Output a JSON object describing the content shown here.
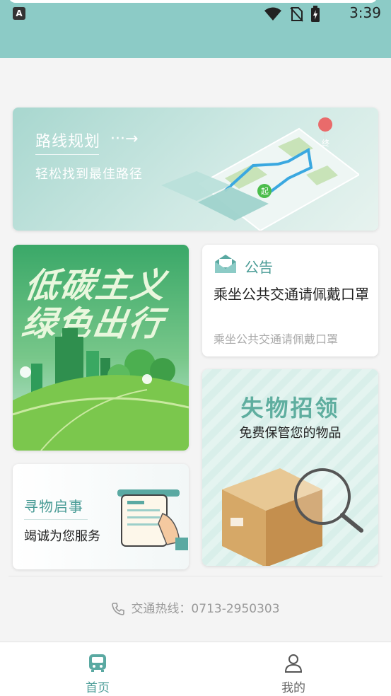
{
  "status_bar": {
    "time": "3:39"
  },
  "route": {
    "title": "路线规划",
    "subtitle": "轻松找到最佳路径",
    "map_start": "起",
    "map_end": "终"
  },
  "eco": {
    "line1": "低碳主义",
    "line2": "绿色出行"
  },
  "notice": {
    "label": "公告",
    "title": "乘坐公共交通请佩戴口罩",
    "subtitle": "乘坐公共交通请佩戴口罩"
  },
  "lost": {
    "title": "失物招领",
    "subtitle": "免费保管您的物品"
  },
  "find": {
    "title": "寻物启事",
    "subtitle": "竭诚为您服务"
  },
  "hotline": "交通热线：0713-2950303",
  "tabs": {
    "home": "首页",
    "me": "我的"
  },
  "colors": {
    "accent": "#4a9c96",
    "header": "#8ccbc6"
  },
  "icons": [
    "phone-icon",
    "bus-icon",
    "user-icon",
    "envelope-icon",
    "arrow-right-icon",
    "magnifier-icon"
  ]
}
